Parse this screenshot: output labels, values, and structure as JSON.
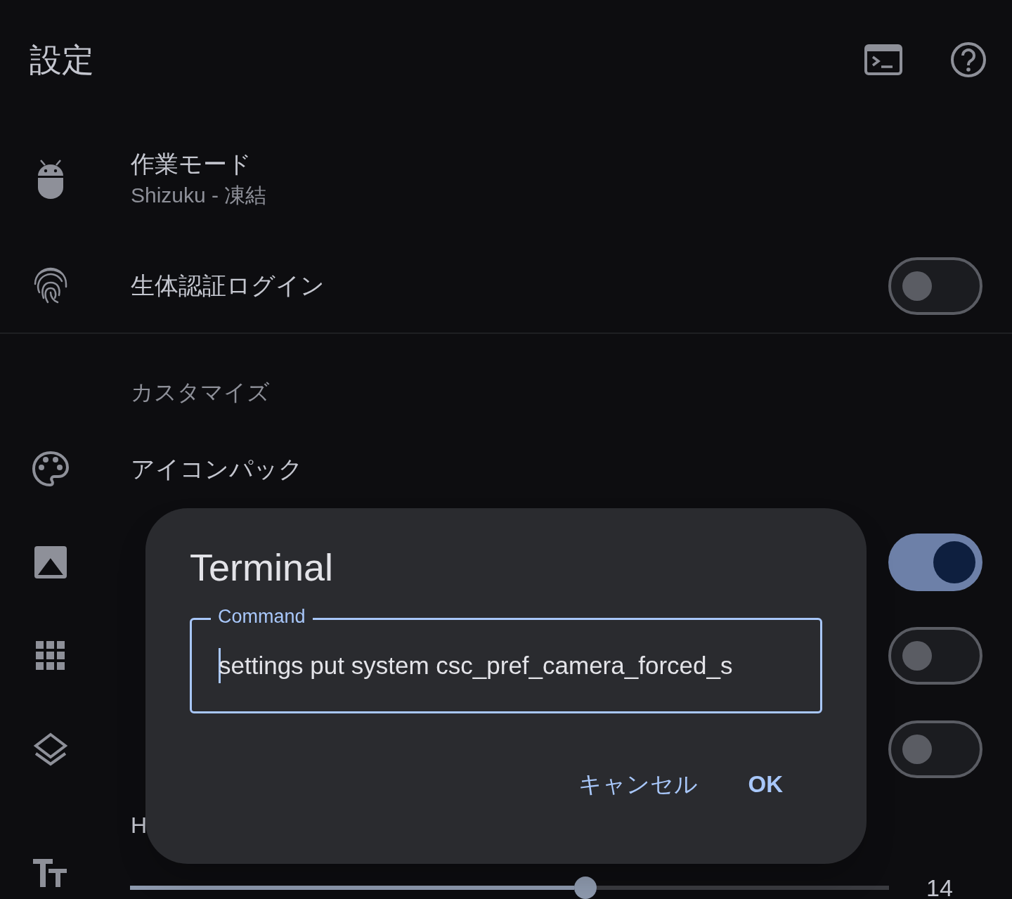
{
  "header": {
    "title": "設定"
  },
  "rows": [
    {
      "kind": "item",
      "title": "作業モード",
      "subtitle": "Shizuku - 凍結"
    },
    {
      "kind": "switch",
      "title": "生体認証ログイン",
      "on": false
    },
    {
      "kind": "divider"
    },
    {
      "kind": "section",
      "title": "カスタマイズ"
    },
    {
      "kind": "item",
      "title": "アイコンパック"
    },
    {
      "kind": "switch",
      "on": true
    },
    {
      "kind": "switch",
      "on": false
    },
    {
      "kind": "switch",
      "on": false
    },
    {
      "kind": "section",
      "title": "H"
    },
    {
      "kind": "slider",
      "level": 0.6,
      "reading": "14"
    }
  ],
  "dialog": {
    "title": "Terminal",
    "field": {
      "label": "Command",
      "value": "settings put system csc_pref_camera_forced_s"
    },
    "buttons": [
      "キャンセル",
      "OK"
    ]
  }
}
